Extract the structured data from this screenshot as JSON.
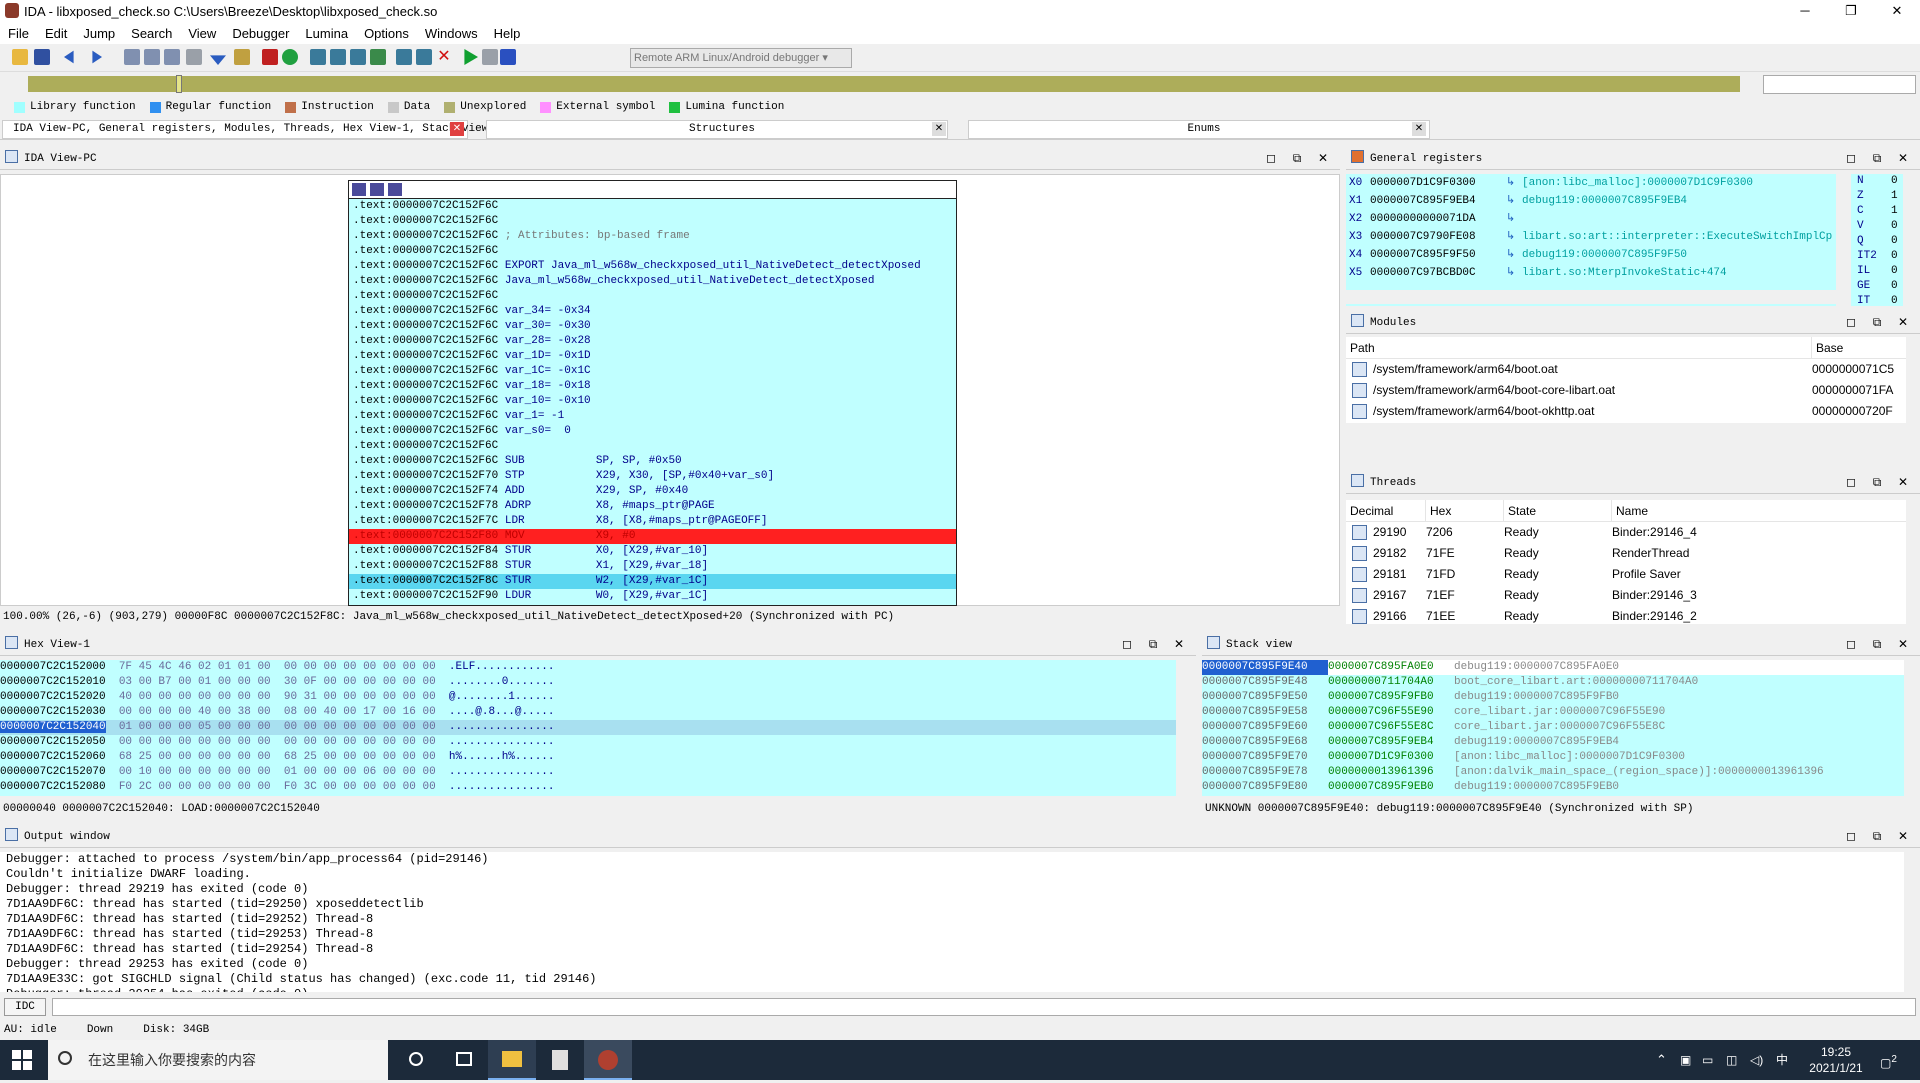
{
  "window": {
    "title": "IDA - libxposed_check.so C:\\Users\\Breeze\\Desktop\\libxposed_check.so",
    "min": "─",
    "max": "❐",
    "close": "✕"
  },
  "menu": [
    "File",
    "Edit",
    "Jump",
    "Search",
    "View",
    "Debugger",
    "Lumina",
    "Options",
    "Windows",
    "Help"
  ],
  "toolbar": {
    "debugger_select": "Remote ARM Linux/Android debugger"
  },
  "legend": [
    {
      "label": "Library function",
      "color": "#a0ffff"
    },
    {
      "label": "Regular function",
      "color": "#3090f0"
    },
    {
      "label": "Instruction",
      "color": "#c0704a"
    },
    {
      "label": "Data",
      "color": "#c8c8c8"
    },
    {
      "label": "Unexplored",
      "color": "#b0b070"
    },
    {
      "label": "External symbol",
      "color": "#ff90ff"
    },
    {
      "label": "Lumina function",
      "color": "#20c040"
    }
  ],
  "tabs": {
    "main": "IDA View-PC, General registers, Modules, Threads, Hex View-1, Stack view",
    "structures": "Structures",
    "enums": "Enums"
  },
  "ida_view": {
    "title": "IDA View-PC",
    "lines": [
      {
        "a": ".text:0000007C2C152F6C",
        "m": "",
        "o": ""
      },
      {
        "a": ".text:0000007C2C152F6C",
        "m": "",
        "o": ""
      },
      {
        "a": ".text:0000007C2C152F6C",
        "m": "; Attributes: bp-based frame",
        "o": "",
        "c": true
      },
      {
        "a": ".text:0000007C2C152F6C",
        "m": "",
        "o": ""
      },
      {
        "a": ".text:0000007C2C152F6C",
        "m": "EXPORT Java_ml_w568w_checkxposed_util_NativeDetect_detectXposed",
        "o": ""
      },
      {
        "a": ".text:0000007C2C152F6C",
        "m": "Java_ml_w568w_checkxposed_util_NativeDetect_detectXposed",
        "o": ""
      },
      {
        "a": ".text:0000007C2C152F6C",
        "m": "",
        "o": ""
      },
      {
        "a": ".text:0000007C2C152F6C",
        "m": "var_34= -0x34",
        "o": ""
      },
      {
        "a": ".text:0000007C2C152F6C",
        "m": "var_30= -0x30",
        "o": ""
      },
      {
        "a": ".text:0000007C2C152F6C",
        "m": "var_28= -0x28",
        "o": ""
      },
      {
        "a": ".text:0000007C2C152F6C",
        "m": "var_1D= -0x1D",
        "o": ""
      },
      {
        "a": ".text:0000007C2C152F6C",
        "m": "var_1C= -0x1C",
        "o": ""
      },
      {
        "a": ".text:0000007C2C152F6C",
        "m": "var_18= -0x18",
        "o": ""
      },
      {
        "a": ".text:0000007C2C152F6C",
        "m": "var_10= -0x10",
        "o": ""
      },
      {
        "a": ".text:0000007C2C152F6C",
        "m": "var_1= -1",
        "o": ""
      },
      {
        "a": ".text:0000007C2C152F6C",
        "m": "var_s0=  0",
        "o": ""
      },
      {
        "a": ".text:0000007C2C152F6C",
        "m": "",
        "o": ""
      },
      {
        "a": ".text:0000007C2C152F6C",
        "m": "SUB",
        "o": "SP, SP, #0x50"
      },
      {
        "a": ".text:0000007C2C152F70",
        "m": "STP",
        "o": "X29, X30, [SP,#0x40+var_s0]"
      },
      {
        "a": ".text:0000007C2C152F74",
        "m": "ADD",
        "o": "X29, SP, #0x40"
      },
      {
        "a": ".text:0000007C2C152F78",
        "m": "ADRP",
        "o": "X8, #maps_ptr@PAGE"
      },
      {
        "a": ".text:0000007C2C152F7C",
        "m": "LDR",
        "o": "X8, [X8,#maps_ptr@PAGEOFF]"
      },
      {
        "a": ".text:0000007C2C152F80",
        "m": "MOV",
        "o": "X9, #0",
        "h": true
      },
      {
        "a": ".text:0000007C2C152F84",
        "m": "STUR",
        "o": "X0, [X29,#var_10]"
      },
      {
        "a": ".text:0000007C2C152F88",
        "m": "STUR",
        "o": "X1, [X29,#var_18]"
      },
      {
        "a": ".text:0000007C2C152F8C",
        "m": "STUR",
        "o": "W2, [X29,#var_1C]",
        "s": true
      },
      {
        "a": ".text:0000007C2C152F90",
        "m": "LDUR",
        "o": "W0, [X29,#var_1C]"
      }
    ],
    "status": "100.00% (26,-6) (903,279) 00000F8C 0000007C2C152F8C: Java_ml_w568w_checkxposed_util_NativeDetect_detectXposed+20 (Synchronized with PC)"
  },
  "registers": {
    "title": "General registers",
    "rows": [
      {
        "n": "X0",
        "v": "0000007D1C9F0300",
        "d": "[anon:libc_malloc]:0000007D1C9F0300"
      },
      {
        "n": "X1",
        "v": "0000007C895F9EB4",
        "d": "debug119:0000007C895F9EB4"
      },
      {
        "n": "X2",
        "v": "00000000000071DA",
        "d": ""
      },
      {
        "n": "X3",
        "v": "0000007C9790FE08",
        "d": "libart.so:art::interpreter::ExecuteSwitchImplCp"
      },
      {
        "n": "X4",
        "v": "0000007C895F9F50",
        "d": "debug119:0000007C895F9F50"
      },
      {
        "n": "X5",
        "v": "0000007C97BCBD0C",
        "d": "libart.so:MterpInvokeStatic+474"
      }
    ],
    "flags": [
      [
        "N",
        "0"
      ],
      [
        "Z",
        "1"
      ],
      [
        "C",
        "1"
      ],
      [
        "V",
        "0"
      ],
      [
        "Q",
        "0"
      ],
      [
        "IT2",
        "0"
      ],
      [
        "IL",
        "0"
      ],
      [
        "GE",
        "0"
      ],
      [
        "IT",
        "0"
      ]
    ]
  },
  "modules": {
    "title": "Modules",
    "cols": [
      "Path",
      "Base"
    ],
    "rows": [
      [
        "/system/framework/arm64/boot.oat",
        "0000000071C5"
      ],
      [
        "/system/framework/arm64/boot-core-libart.oat",
        "0000000071FA"
      ],
      [
        "/system/framework/arm64/boot-okhttp.oat",
        "00000000720F"
      ]
    ]
  },
  "threads": {
    "title": "Threads",
    "cols": [
      "Decimal",
      "Hex",
      "State",
      "Name"
    ],
    "rows": [
      [
        "29190",
        "7206",
        "Ready",
        "Binder:29146_4"
      ],
      [
        "29182",
        "71FE",
        "Ready",
        "RenderThread"
      ],
      [
        "29181",
        "71FD",
        "Ready",
        "Profile Saver"
      ],
      [
        "29167",
        "71EF",
        "Ready",
        "Binder:29146_3"
      ],
      [
        "29166",
        "71EE",
        "Ready",
        "Binder:29146_2"
      ]
    ]
  },
  "hex": {
    "title": "Hex View-1",
    "rows": [
      {
        "a": "0000007C2C152000",
        "b": "7F 45 4C 46 02 01 01 00  00 00 00 00 00 00 00 00",
        "s": ".ELF............"
      },
      {
        "a": "0000007C2C152010",
        "b": "03 00 B7 00 01 00 00 00  30 0F 00 00 00 00 00 00",
        "s": "........0......."
      },
      {
        "a": "0000007C2C152020",
        "b": "40 00 00 00 00 00 00 00  90 31 00 00 00 00 00 00",
        "s": "@........1......"
      },
      {
        "a": "0000007C2C152030",
        "b": "00 00 00 00 40 00 38 00  08 00 40 00 17 00 16 00",
        "s": "....@.8...@....."
      },
      {
        "a": "0000007C2C152040",
        "b": "01 00 00 00 05 00 00 00  00 00 00 00 00 00 00 00",
        "s": "................",
        "cur": true
      },
      {
        "a": "0000007C2C152050",
        "b": "00 00 00 00 00 00 00 00  00 00 00 00 00 00 00 00",
        "s": "................"
      },
      {
        "a": "0000007C2C152060",
        "b": "68 25 00 00 00 00 00 00  68 25 00 00 00 00 00 00",
        "s": "h%......h%......"
      },
      {
        "a": "0000007C2C152070",
        "b": "00 10 00 00 00 00 00 00  01 00 00 00 06 00 00 00",
        "s": "................"
      },
      {
        "a": "0000007C2C152080",
        "b": "F0 2C 00 00 00 00 00 00  F0 3C 00 00 00 00 00 00",
        "s": "................"
      }
    ],
    "status": "00000040 0000007C2C152040: LOAD:0000007C2C152040"
  },
  "stack": {
    "title": "Stack view",
    "rows": [
      {
        "a": "0000007C895F9E40",
        "v": "0000007C895FA0E0",
        "d": "debug119:0000007C895FA0E0",
        "top": true
      },
      {
        "a": "0000007C895F9E48",
        "v": "00000000711704A0",
        "d": "boot_core_libart.art:00000000711704A0"
      },
      {
        "a": "0000007C895F9E50",
        "v": "0000007C895F9FB0",
        "d": "debug119:0000007C895F9FB0"
      },
      {
        "a": "0000007C895F9E58",
        "v": "0000007C96F55E90",
        "d": "core_libart.jar:0000007C96F55E90"
      },
      {
        "a": "0000007C895F9E60",
        "v": "0000007C96F55E8C",
        "d": "core_libart.jar:0000007C96F55E8C"
      },
      {
        "a": "0000007C895F9E68",
        "v": "0000007C895F9EB4",
        "d": "debug119:0000007C895F9EB4"
      },
      {
        "a": "0000007C895F9E70",
        "v": "0000007D1C9F0300",
        "d": "[anon:libc_malloc]:0000007D1C9F0300"
      },
      {
        "a": "0000007C895F9E78",
        "v": "0000000013961396",
        "d": "[anon:dalvik_main_space_(region_space)]:0000000013961396"
      },
      {
        "a": "0000007C895F9E80",
        "v": "0000007C895F9EB0",
        "d": "debug119:0000007C895F9EB0"
      }
    ],
    "status": "UNKNOWN 0000007C895F9E40: debug119:0000007C895F9E40 (Synchronized with SP)"
  },
  "output": {
    "title": "Output window",
    "lines": [
      "Debugger: attached to process /system/bin/app_process64 (pid=29146)",
      "Couldn't initialize DWARF loading.",
      "Debugger: thread 29219 has exited (code 0)",
      "7D1AA9DF6C: thread has started (tid=29250) xposeddetectlib",
      "7D1AA9DF6C: thread has started (tid=29252) Thread-8",
      "7D1AA9DF6C: thread has started (tid=29253) Thread-8",
      "7D1AA9DF6C: thread has started (tid=29254) Thread-8",
      "Debugger: thread 29253 has exited (code 0)",
      "7D1AA9E33C: got SIGCHLD signal (Child status has changed) (exc.code 11, tid 29146)",
      "Debugger: thread 29254 has exited (code 0)"
    ],
    "idc_label": "IDC"
  },
  "statusbar": {
    "au": "AU:  idle",
    "dir": "Down",
    "disk": "Disk: 34GB"
  },
  "taskbar": {
    "search_placeholder": "在这里输入你要搜索的内容",
    "time": "19:25",
    "date": "2021/1/21",
    "ime": "中",
    "notif": "2"
  }
}
